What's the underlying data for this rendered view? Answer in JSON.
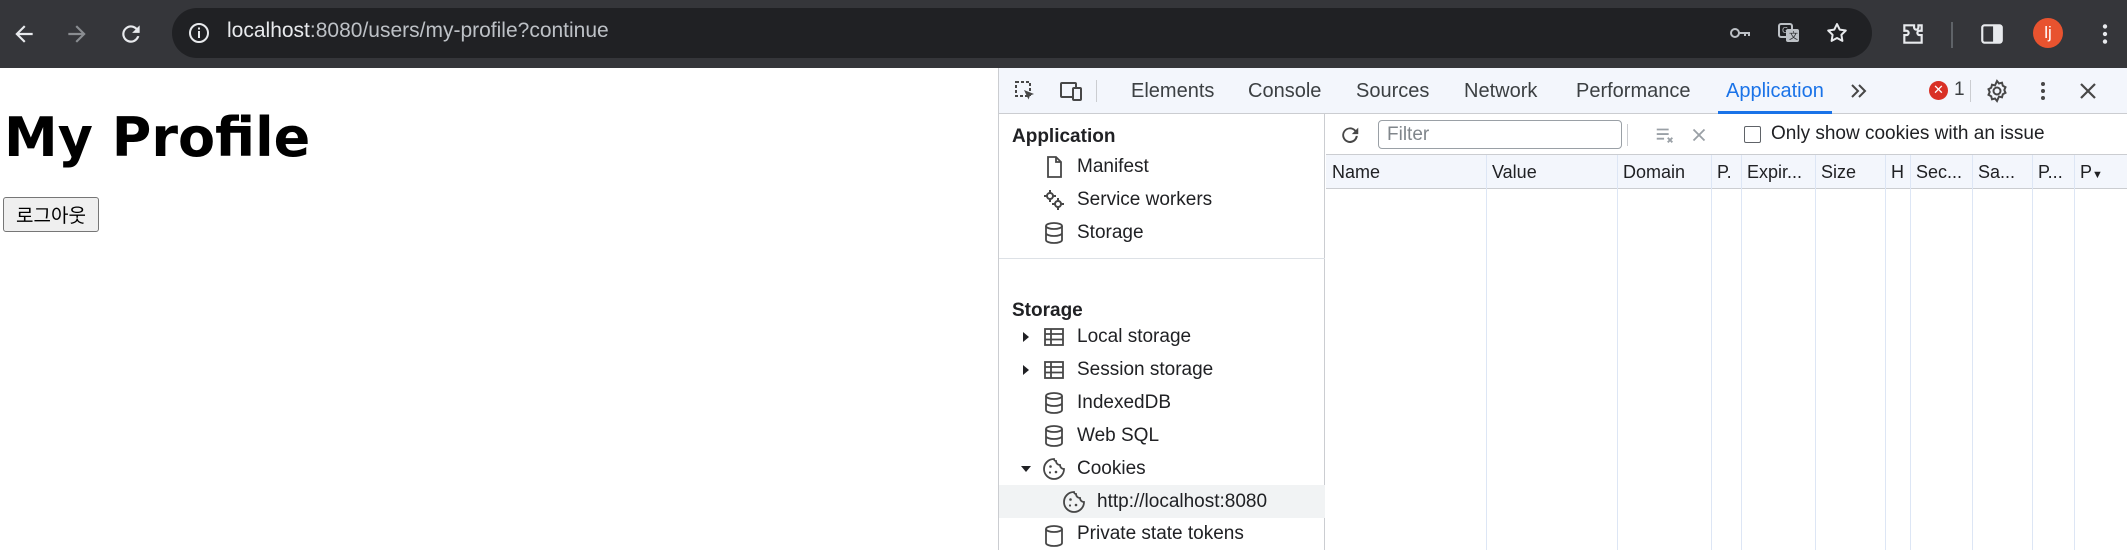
{
  "browser": {
    "url_host": "localhost",
    "url_rest": ":8080/users/my-profile?continue",
    "profile_initial": "lj"
  },
  "page": {
    "heading": "My Profile",
    "logout_label": "로그아웃"
  },
  "devtools": {
    "tabs": [
      "Elements",
      "Console",
      "Sources",
      "Network",
      "Performance",
      "Application"
    ],
    "active_tab": "Application",
    "error_count": "1",
    "sidebar": {
      "application_header": "Application",
      "application_items": [
        "Manifest",
        "Service workers",
        "Storage"
      ],
      "storage_header": "Storage",
      "storage_items": [
        "Local storage",
        "Session storage",
        "IndexedDB",
        "Web SQL",
        "Cookies"
      ],
      "cookie_origin": "http://localhost:8080",
      "partial_item": "Private state tokens"
    },
    "filter_placeholder": "Filter",
    "only_issue_label": "Only show cookies with an issue",
    "columns": [
      "Name",
      "Value",
      "Domain",
      "P.",
      "Expir...",
      "Size",
      "H",
      "Sec...",
      "Sa...",
      "P...",
      "P"
    ]
  }
}
